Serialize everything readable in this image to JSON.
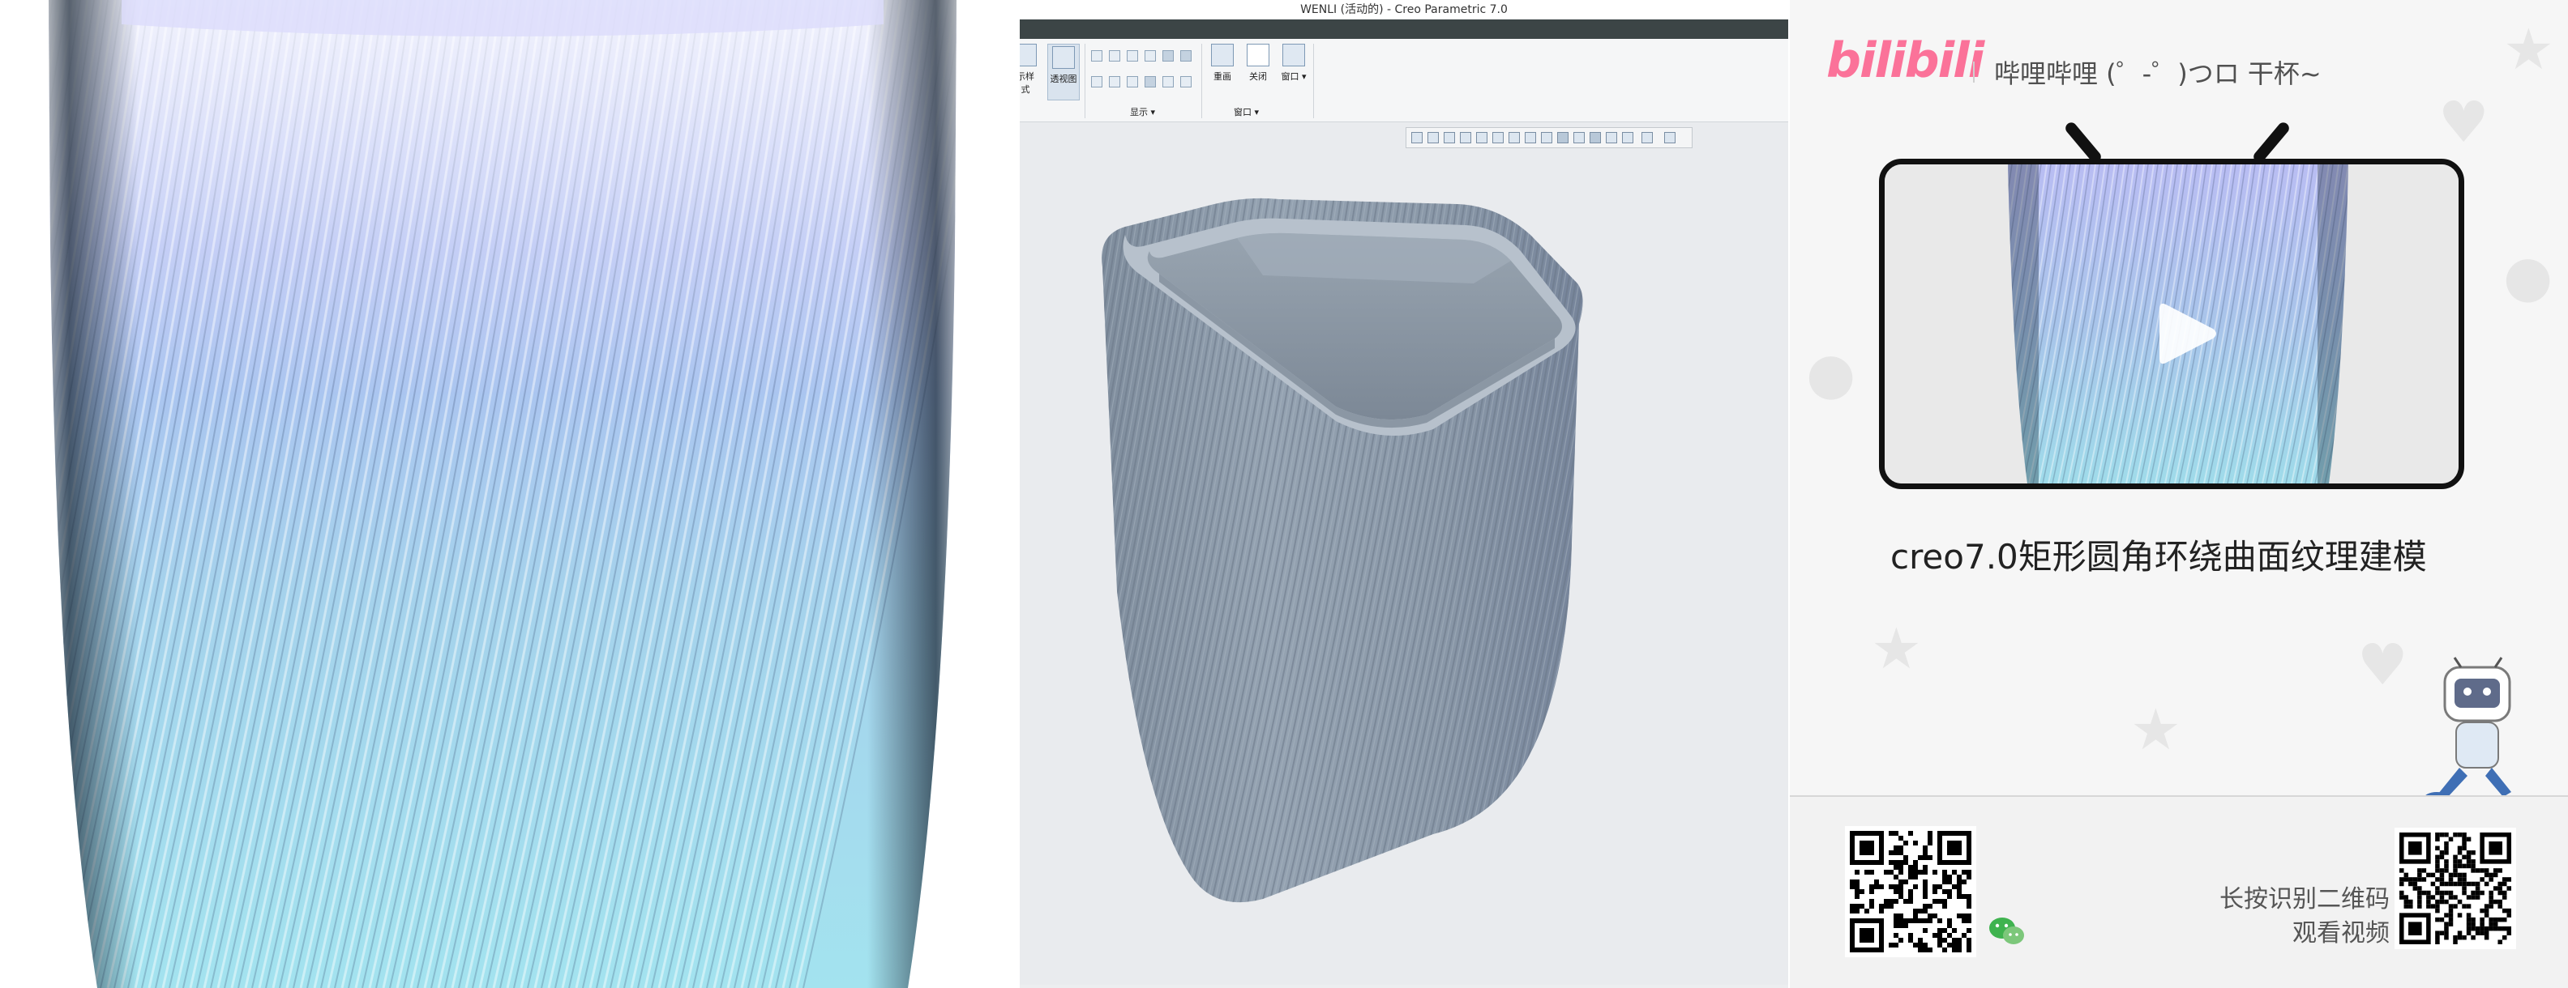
{
  "creo": {
    "window_title": "WENLI (活动的) - Creo Parametric 7.0",
    "ribbon": {
      "style_label": "示样式",
      "perspective_label": "透视图",
      "display_group": "显示",
      "redraw_label": "重画",
      "close_label": "关闭",
      "window_group": "窗口",
      "window_label": "窗口"
    }
  },
  "bili": {
    "logo": "bilibili",
    "slogan": "哔哩哔哩 (゜-゜)つロ 干杯~",
    "video_title": "creo7.0矩形圆角环绕曲面纹理建模",
    "qr_hint_line1": "长按识别二维码",
    "qr_hint_line2": "观看视频"
  },
  "colors": {
    "bili_pink": "#fb7299",
    "cup_gray": "#8a98a8",
    "render_top": "#b8bff5",
    "render_bottom": "#a8e2ee"
  },
  "icons": [
    "play-icon",
    "wechat-icon",
    "qr-code",
    "bilibili-mascot"
  ]
}
